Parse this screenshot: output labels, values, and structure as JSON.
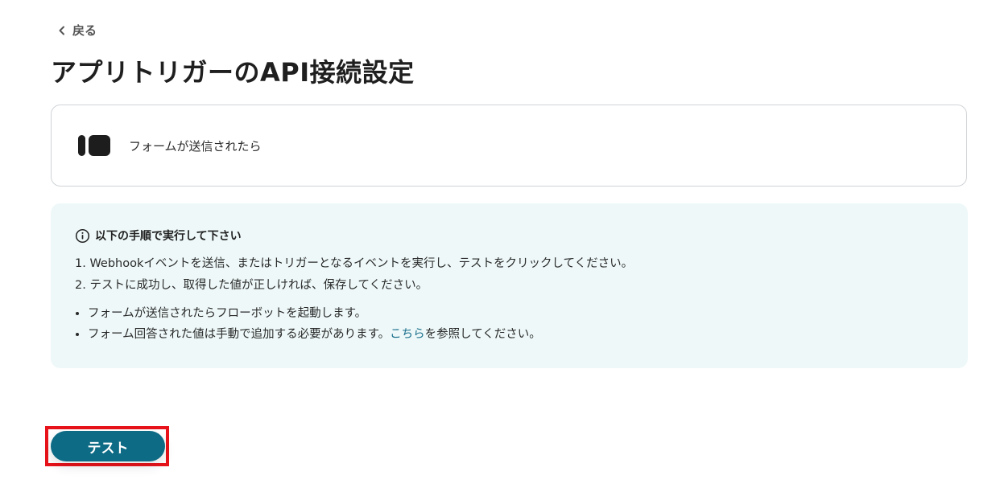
{
  "nav": {
    "back_label": "戻る"
  },
  "page": {
    "title": "アプリトリガーのAPI接続設定"
  },
  "trigger": {
    "label": "フォームが送信されたら",
    "icon": "form-app-icon"
  },
  "instructions": {
    "heading": "以下の手順で実行して下さい",
    "steps": [
      "1. Webhookイベントを送信、またはトリガーとなるイベントを実行し、テストをクリックしてください。",
      "2. テストに成功し、取得した値が正しければ、保存してください。"
    ],
    "bullet_1": "フォームが送信されたらフローボットを起動します。",
    "bullet_2_before": "フォーム回答された値は手動で追加する必要があります。",
    "bullet_2_link": "こちら",
    "bullet_2_after": "を参照してください。"
  },
  "actions": {
    "test_label": "テスト"
  },
  "colors": {
    "accent": "#0d6b85",
    "info_bg": "#eef8f8",
    "link": "#1a6f8c",
    "highlight": "#e8131a"
  }
}
